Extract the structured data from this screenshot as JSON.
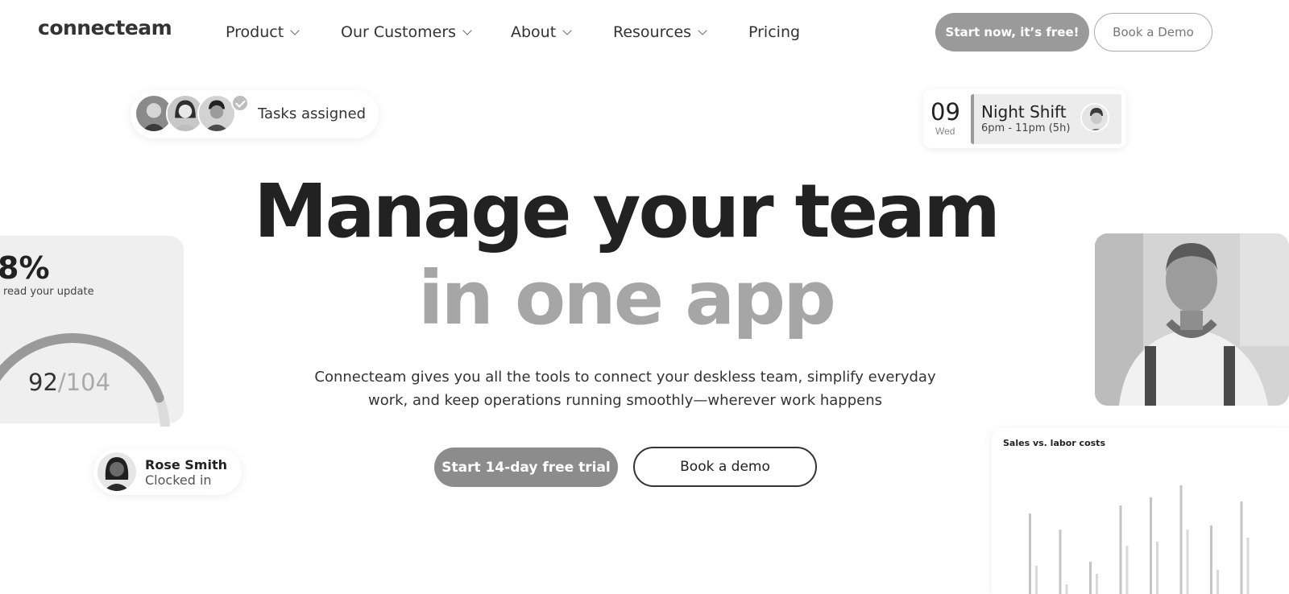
{
  "nav": {
    "logo": "connecteam",
    "items": [
      {
        "label": "Product"
      },
      {
        "label": "Our Customers"
      },
      {
        "label": "About"
      },
      {
        "label": "Resources"
      },
      {
        "label": "Pricing"
      }
    ],
    "start_label": "Start now, it’s free!",
    "demo_label": "Book a Demo"
  },
  "tasks_card": {
    "label": "Tasks assigned"
  },
  "shift_card": {
    "day": "09",
    "weekday": "Wed",
    "title": "Night Shift",
    "time": "6pm - 11pm (5h)"
  },
  "read_card": {
    "percent": "8%",
    "label": "read your update",
    "read": "92",
    "total": "/104",
    "fraction": 0.885
  },
  "rose_card": {
    "name": "Rose Smith",
    "status": "Clocked in"
  },
  "hero": {
    "line1": "Manage your team",
    "line2": "in one app",
    "subtitle": "Connecteam gives you all the tools to connect your deskless team, simplify everyday work, and keep operations running smoothly—wherever work happens",
    "trial_label": "Start 14-day free trial",
    "demo_label": "Book a demo"
  },
  "chart_data": {
    "type": "bar",
    "title": "Sales vs. labor costs",
    "series": [
      {
        "values": [
          100,
          80,
          40,
          110,
          120,
          135,
          85,
          115
        ]
      },
      {
        "values": [
          35,
          12,
          25,
          60,
          65,
          80,
          30,
          70
        ]
      }
    ],
    "ylim": [
      0,
      150
    ]
  },
  "colors": {
    "accent": "#9a9a9a",
    "text": "#222222",
    "muted": "#a6a6a6"
  }
}
